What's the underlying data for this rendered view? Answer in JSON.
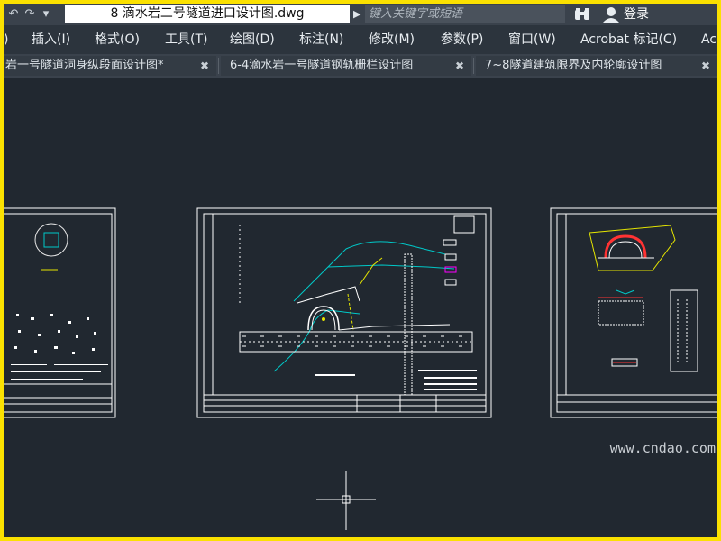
{
  "titlebar": {
    "document_title": "8 滴水岩二号隧道进口设计图.dwg",
    "search_placeholder": "键入关键字或短语",
    "login_label": "登录",
    "colors": {
      "bar": "#3a424c",
      "title_box": "#ffffff"
    }
  },
  "menu": {
    "items": [
      ")",
      "插入(I)",
      "格式(O)",
      "工具(T)",
      "绘图(D)",
      "标注(N)",
      "修改(M)",
      "参数(P)",
      "窗口(W)",
      "Acrobat 标记(C)",
      "Ac"
    ]
  },
  "tabs": [
    {
      "label": "岩一号隧道洞身纵段面设计图*",
      "close": "✖"
    },
    {
      "label": "6-4滴水岩一号隧道钢轨栅栏设计图",
      "close": "✖"
    },
    {
      "label": "7~8隧道建筑限界及内轮廓设计图",
      "close": "✖"
    }
  ],
  "canvas": {
    "background": "#212830",
    "drawing_line_color": "#ffffff",
    "accent_colors": [
      "#00c8c8",
      "#e6e600",
      "#ff00ff",
      "#ff3333"
    ]
  },
  "watermark": "www.cndao.com",
  "icons": {
    "toolbar": [
      "undo-icon",
      "redo-icon",
      "dropdown-icon"
    ],
    "search": "binoculars-icon",
    "user": "user-icon"
  }
}
